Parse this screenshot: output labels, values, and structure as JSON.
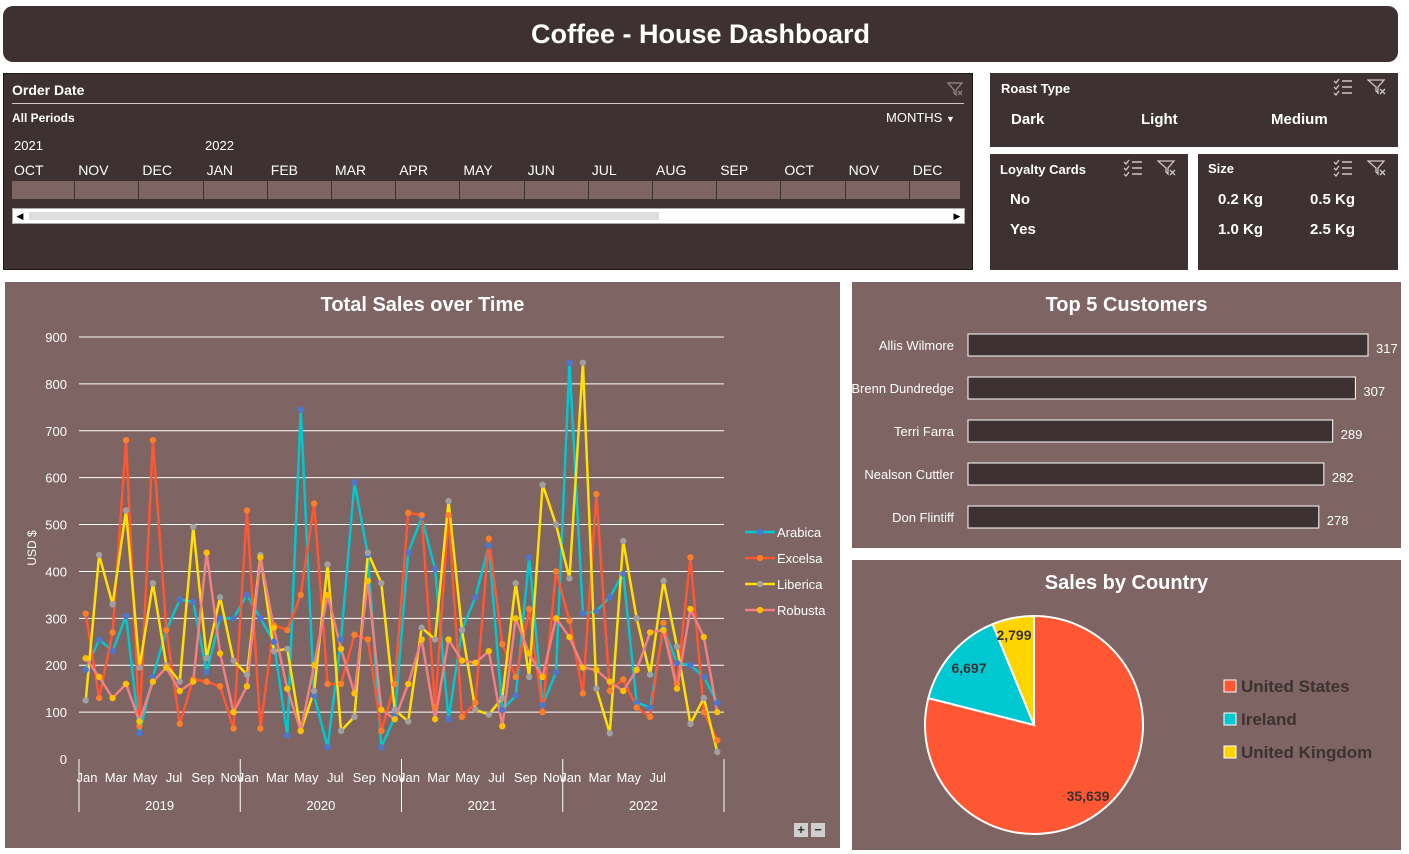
{
  "header": {
    "title": "Coffee - House Dashboard"
  },
  "order_date": {
    "title": "Order Date",
    "period_label": "All Periods",
    "level_label": "MONTHS",
    "years": [
      "2021",
      "2022"
    ],
    "months": [
      "OCT",
      "NOV",
      "DEC",
      "JAN",
      "FEB",
      "MAR",
      "APR",
      "MAY",
      "JUN",
      "JUL",
      "AUG",
      "SEP",
      "OCT",
      "NOV",
      "DEC"
    ]
  },
  "roast": {
    "title": "Roast Type",
    "items": [
      "Dark",
      "Light",
      "Medium"
    ]
  },
  "loyalty": {
    "title": "Loyalty Cards",
    "items": [
      "No",
      "Yes"
    ]
  },
  "size": {
    "title": "Size",
    "items": [
      "0.2 Kg",
      "0.5 Kg",
      "1.0 Kg",
      "2.5 Kg"
    ]
  },
  "colors": {
    "arabica": "#00c8d0",
    "excelsa": "#ff5733",
    "liberica": "#ffe000",
    "robusta": "#f28080",
    "us": "#ff5733",
    "ireland": "#00c8d0",
    "uk": "#ffd400",
    "panel": "#7e6462",
    "dark": "#3e3131"
  },
  "zoom_buttons": {
    "plus": "+",
    "minus": "−"
  },
  "chart_data": [
    {
      "type": "line",
      "title": "Total Sales over Time",
      "xlabel": "",
      "ylabel": "USD $",
      "ylim": [
        0,
        900
      ],
      "yticks": [
        0,
        100,
        200,
        300,
        400,
        500,
        600,
        700,
        800,
        900
      ],
      "x_month_labels": [
        "Jan",
        "Mar",
        "May",
        "Jul",
        "Sep",
        "Nov",
        "Jan",
        "Mar",
        "May",
        "Jul",
        "Sep",
        "Nov",
        "Jan",
        "Mar",
        "May",
        "Jul",
        "Sep",
        "Nov",
        "Jan",
        "Mar",
        "May",
        "Jul"
      ],
      "x_years": [
        "2019",
        "2020",
        "2021",
        "2022"
      ],
      "grid": true,
      "legend_position": "right",
      "series": [
        {
          "name": "Arabica",
          "color_key": "arabica",
          "values": [
            190,
            255,
            230,
            305,
            55,
            175,
            275,
            340,
            335,
            185,
            300,
            300,
            350,
            300,
            250,
            50,
            745,
            135,
            25,
            255,
            590,
            435,
            25,
            90,
            440,
            515,
            405,
            85,
            275,
            345,
            455,
            105,
            135,
            430,
            115,
            185,
            845,
            310,
            315,
            345,
            395,
            120,
            110,
            280,
            205,
            200,
            175,
            120
          ]
        },
        {
          "name": "Excelsa",
          "color_key": "excelsa",
          "values": [
            310,
            130,
            270,
            680,
            70,
            680,
            275,
            75,
            170,
            165,
            155,
            65,
            530,
            65,
            285,
            275,
            350,
            545,
            160,
            160,
            265,
            255,
            60,
            160,
            525,
            520,
            110,
            520,
            90,
            120,
            470,
            245,
            175,
            320,
            100,
            400,
            295,
            140,
            565,
            145,
            170,
            110,
            90,
            290,
            160,
            430,
            100,
            40
          ]
        },
        {
          "name": "Liberica",
          "color_key": "liberica",
          "values": [
            125,
            435,
            330,
            530,
            195,
            375,
            200,
            165,
            495,
            215,
            345,
            210,
            180,
            435,
            230,
            235,
            60,
            145,
            415,
            60,
            90,
            440,
            375,
            105,
            80,
            280,
            255,
            550,
            275,
            105,
            95,
            130,
            375,
            175,
            585,
            500,
            385,
            845,
            150,
            55,
            465,
            300,
            180,
            380,
            240,
            75,
            130,
            15
          ]
        },
        {
          "name": "Robusta",
          "color_key": "robusta",
          "values": [
            215,
            175,
            130,
            160,
            80,
            165,
            195,
            145,
            165,
            440,
            225,
            100,
            155,
            430,
            280,
            150,
            60,
            200,
            350,
            235,
            140,
            380,
            105,
            85,
            160,
            255,
            85,
            255,
            210,
            205,
            230,
            70,
            300,
            225,
            175,
            300,
            260,
            195,
            190,
            165,
            145,
            190,
            270,
            275,
            150,
            320,
            260,
            100
          ]
        }
      ]
    },
    {
      "type": "bar",
      "orientation": "horizontal",
      "title": "Top 5 Customers",
      "categories": [
        "Allis Wilmore",
        "Brenn Dundredge",
        "Terri Farra",
        "Nealson Cuttler",
        "Don Flintiff"
      ],
      "values": [
        317,
        307,
        289,
        282,
        278
      ],
      "data_labels": [
        "317",
        "307",
        "289",
        "282",
        "278"
      ]
    },
    {
      "type": "pie",
      "title": "Sales by Country",
      "labels": [
        "United States",
        "Ireland",
        "United Kingdom"
      ],
      "values": [
        35639,
        6697,
        2799
      ],
      "data_labels": [
        "35,639",
        "6,697",
        "2,799"
      ],
      "color_keys": [
        "us",
        "ireland",
        "uk"
      ],
      "legend_position": "right"
    }
  ]
}
